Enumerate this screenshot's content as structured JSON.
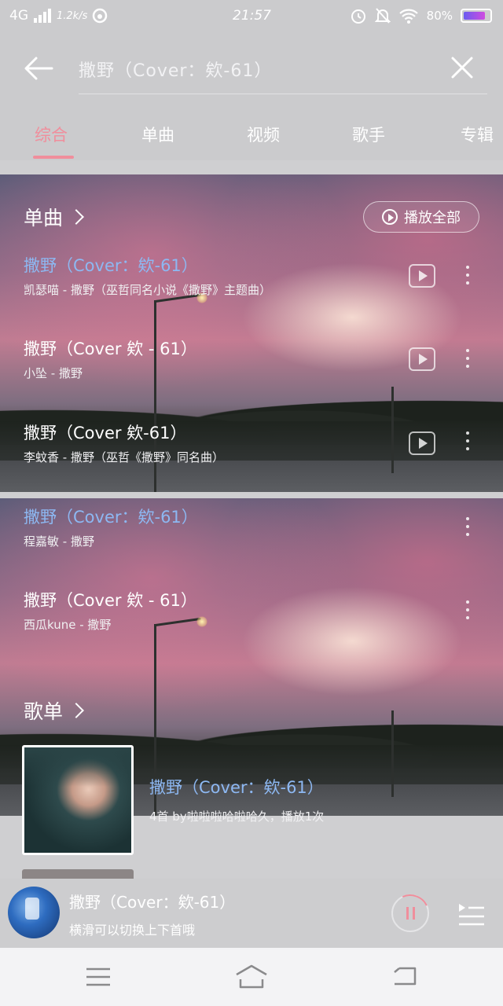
{
  "status_bar": {
    "network": "4G",
    "speed": "1.2k/s",
    "time": "21:57",
    "battery": "80%"
  },
  "search": {
    "value": "撒野（Cover：欸-61）"
  },
  "tabs": [
    {
      "label": "综合",
      "active": true
    },
    {
      "label": "单曲",
      "active": false
    },
    {
      "label": "视频",
      "active": false
    },
    {
      "label": "歌手",
      "active": false
    },
    {
      "label": "专辑",
      "active": false
    }
  ],
  "songs_section": {
    "title": "单曲",
    "play_all_label": "播放全部",
    "items": [
      {
        "title": "撒野（Cover：欸-61）",
        "subtitle": "凯瑟喵 - 撒野（巫哲同名小说《撒野》主题曲）",
        "highlighted": true
      },
      {
        "title": "撒野（Cover 欸 - 61）",
        "subtitle": "小坠 - 撒野",
        "highlighted": false
      },
      {
        "title": "撒野（Cover 欸-61）",
        "subtitle": "李蚊香 - 撒野（巫哲《撒野》同名曲）",
        "highlighted": false
      },
      {
        "title": "撒野（Cover：欸-61）",
        "subtitle": "程嘉敏 - 撒野",
        "highlighted": true
      },
      {
        "title": "撒野（Cover 欸 - 61）",
        "subtitle": "西瓜kune - 撒野",
        "highlighted": false
      }
    ]
  },
  "playlist_section": {
    "title": "歌单",
    "items": [
      {
        "title": "撒野（Cover：欸-61）",
        "subtitle": "4首    by啦啦啦哈啦哈久，播放1次"
      }
    ]
  },
  "mini_player": {
    "title": "撒野（Cover：欸-61）",
    "subtitle": "横滑可以切换上下首哦"
  },
  "colors": {
    "accent": "#f08e9c",
    "link_blue": "#8db8f2",
    "header_bg": "#cbcbcd"
  }
}
